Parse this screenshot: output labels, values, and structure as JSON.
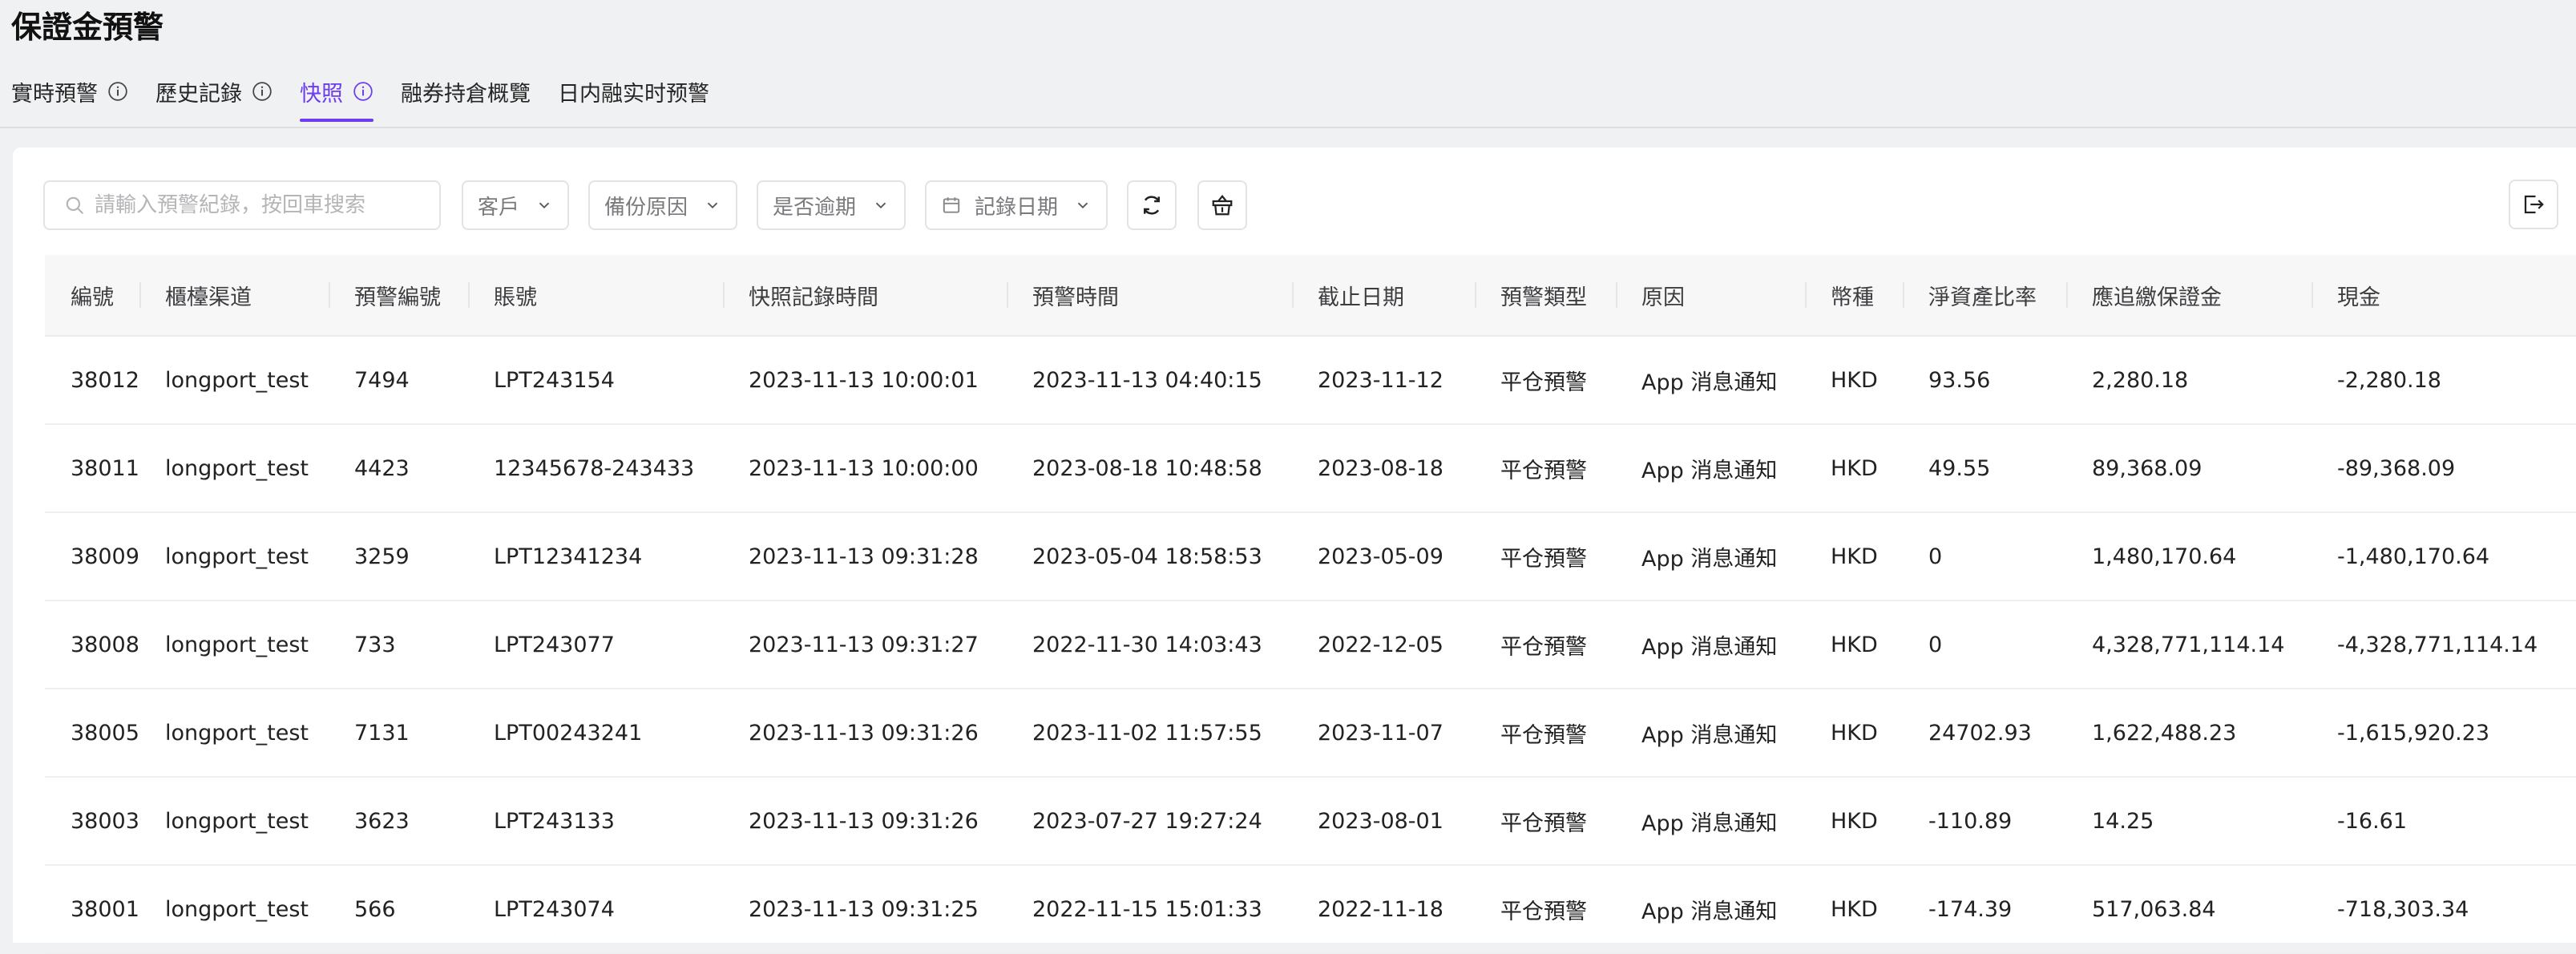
{
  "page_title": "保證金預警",
  "tabs": [
    {
      "label": "實時預警",
      "has_info": true,
      "active": false
    },
    {
      "label": "歷史記錄",
      "has_info": true,
      "active": false
    },
    {
      "label": "快照",
      "has_info": true,
      "active": true
    },
    {
      "label": "融券持倉概覽",
      "has_info": false,
      "active": false
    },
    {
      "label": "日内融实时预警",
      "has_info": false,
      "active": false
    }
  ],
  "toolbar": {
    "search_placeholder": "請輸入預警紀錄，按回車搜索",
    "filter_customer": "客戶",
    "filter_backup_reason": "備份原因",
    "filter_overdue": "是否逾期",
    "filter_record_date": "記錄日期"
  },
  "table": {
    "columns": [
      "編號",
      "櫃檯渠道",
      "預警編號",
      "賬號",
      "快照記錄時間",
      "預警時間",
      "截止日期",
      "預警類型",
      "原因",
      "幣種",
      "淨資產比率",
      "應追繳保證金",
      "現金"
    ],
    "rows": [
      [
        "38012",
        "longport_test",
        "7494",
        "LPT243154",
        "2023-11-13 10:00:01",
        "2023-11-13 04:40:15",
        "2023-11-12",
        "平仓預警",
        "App 消息通知",
        "HKD",
        "93.56",
        "2,280.18",
        "-2,280.18"
      ],
      [
        "38011",
        "longport_test",
        "4423",
        "12345678-243433",
        "2023-11-13 10:00:00",
        "2023-08-18 10:48:58",
        "2023-08-18",
        "平仓預警",
        "App 消息通知",
        "HKD",
        "49.55",
        "89,368.09",
        "-89,368.09"
      ],
      [
        "38009",
        "longport_test",
        "3259",
        "LPT12341234",
        "2023-11-13 09:31:28",
        "2023-05-04 18:58:53",
        "2023-05-09",
        "平仓預警",
        "App 消息通知",
        "HKD",
        "0",
        "1,480,170.64",
        "-1,480,170.64"
      ],
      [
        "38008",
        "longport_test",
        "733",
        "LPT243077",
        "2023-11-13 09:31:27",
        "2022-11-30 14:03:43",
        "2022-12-05",
        "平仓預警",
        "App 消息通知",
        "HKD",
        "0",
        "4,328,771,114.14",
        "-4,328,771,114.14"
      ],
      [
        "38005",
        "longport_test",
        "7131",
        "LPT00243241",
        "2023-11-13 09:31:26",
        "2023-11-02 11:57:55",
        "2023-11-07",
        "平仓預警",
        "App 消息通知",
        "HKD",
        "24702.93",
        "1,622,488.23",
        "-1,615,920.23"
      ],
      [
        "38003",
        "longport_test",
        "3623",
        "LPT243133",
        "2023-11-13 09:31:26",
        "2023-07-27 19:27:24",
        "2023-08-01",
        "平仓預警",
        "App 消息通知",
        "HKD",
        "-110.89",
        "14.25",
        "-16.61"
      ],
      [
        "38001",
        "longport_test",
        "566",
        "LPT243074",
        "2023-11-13 09:31:25",
        "2022-11-15 15:01:33",
        "2022-11-18",
        "平仓預警",
        "App 消息通知",
        "HKD",
        "-174.39",
        "517,063.84",
        "-718,303.34"
      ]
    ]
  },
  "colors": {
    "accent": "#6c3cf0"
  },
  "icons": [
    "info-icon",
    "search-icon",
    "chevron-down-icon",
    "calendar-icon",
    "refresh-icon",
    "basket-icon",
    "export-icon"
  ]
}
